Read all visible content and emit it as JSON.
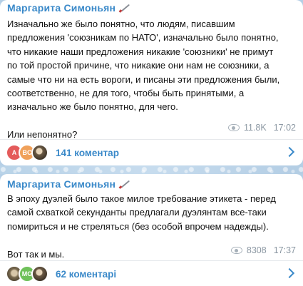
{
  "posts": [
    {
      "author": "Маргарита Симоньян",
      "text": "Изначально же было понятно, что людям, писавшим\nпредложения 'союзникам по НАТО', изначально было понятно,\nчто никакие наши предложения никакие 'союзники' не примут\nпо той простой причине, что никакие они нам не союзники, а\nсамые что ни на есть вороги, и писаны эти предложения были,\nсоответственно, не для того, чтобы быть принятыми, а\nизначально же было понятно, для чего.\n\nИли непонятно?",
      "views": "11.8K",
      "time": "17:02",
      "avatars": [
        {
          "initials": "A",
          "color": "#e45b5b"
        },
        {
          "initials": "BC",
          "color": "#f0a15a"
        }
      ],
      "comments_label": "141 коментар"
    },
    {
      "author": "Маргарита Симоньян",
      "text": "В эпоху дуэлей было такое милое требование этикета - перед\nсамой схваткой секунданты предлагали дуэлянтам все-таки\nпомириться и не стреляться (без особой впрочем надежды).\n\nВот так и мы.",
      "views": "8308",
      "time": "17:37",
      "avatars": [
        {
          "initials": "",
          "color": "#6b5a45"
        },
        {
          "initials": "MO",
          "color": "#6fc15a"
        }
      ],
      "comments_label": "62 коментарі"
    }
  ],
  "colors": {
    "accent": "#3a89c9",
    "meta": "#8c98a3",
    "background": "#b5cfe6"
  },
  "icons": [
    "pen-icon",
    "eye-icon",
    "chevron-right-icon"
  ]
}
